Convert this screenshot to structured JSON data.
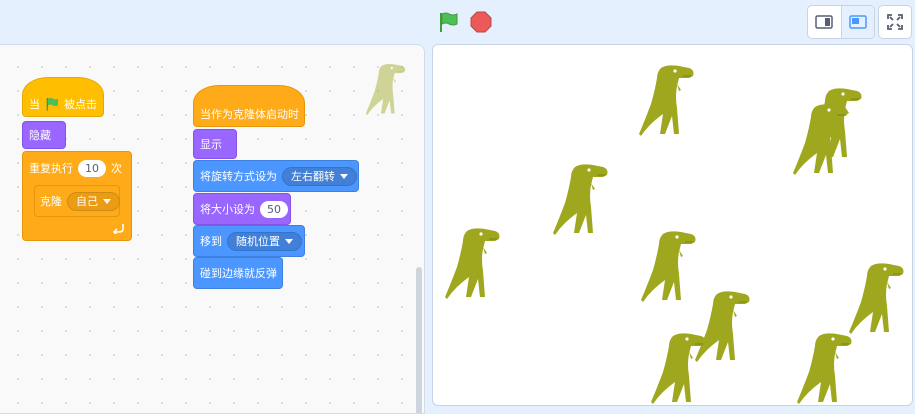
{
  "toolbar": {
    "green_flag_icon": "green-flag-icon",
    "stop_icon": "stop-icon",
    "small_stage_icon": "small-stage-icon",
    "large_stage_icon": "large-stage-icon",
    "fullscreen_icon": "fullscreen-icon"
  },
  "script1": {
    "hat_when": "当",
    "hat_clicked": "被点击",
    "hide": "隐藏",
    "repeat": "重复执行",
    "repeat_count": "10",
    "repeat_unit": "次",
    "clone": "克隆",
    "clone_target": "自己"
  },
  "script2": {
    "hat": "当作为克隆体启动时",
    "show": "显示",
    "rotation_label": "将旋转方式设为",
    "rotation_value": "左右翻转",
    "size_label": "将大小设为",
    "size_value": "50",
    "goto_label": "移到",
    "goto_value": "随机位置",
    "bounce": "碰到边缘就反弹"
  },
  "colors": {
    "events": "#ffbf00",
    "looks": "#9966ff",
    "motion": "#4c97ff",
    "control": "#ffab19",
    "dino": "#9fa71f"
  }
}
